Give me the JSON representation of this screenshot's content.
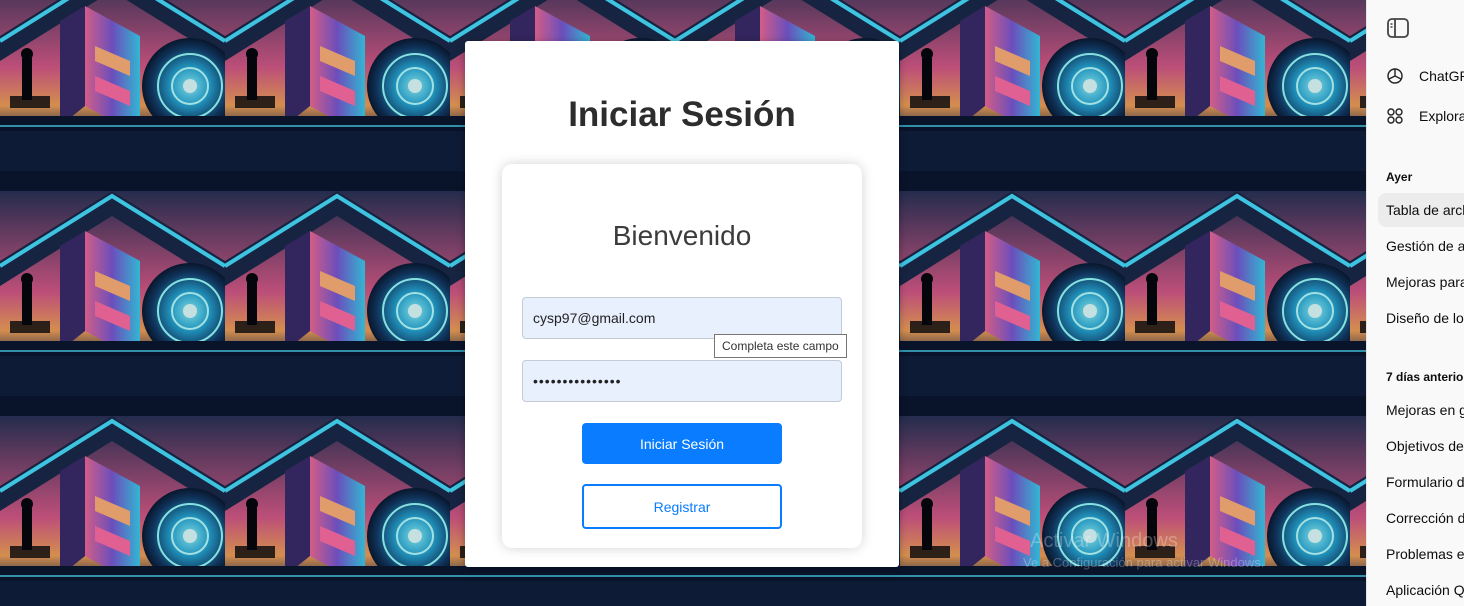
{
  "login": {
    "page_title": "Iniciar Sesión",
    "welcome": "Bienvenido",
    "email_value": "cysp97@gmail.com",
    "password_value": "•••••••••••••••",
    "tooltip": "Completa este campo",
    "login_button": "Iniciar Sesión",
    "register_button": "Registrar"
  },
  "watermark": {
    "line1": "Activar Windows",
    "line2": "Ve a Configuración para activar Windows."
  },
  "sidebar": {
    "top_items": [
      {
        "label": "ChatGP",
        "icon": "openai-icon"
      },
      {
        "label": "Explora",
        "icon": "grid-icon"
      }
    ],
    "sections": [
      {
        "title": "Ayer",
        "items": [
          "Tabla de arch",
          "Gestión de a",
          "Mejoras para",
          "Diseño de loc"
        ]
      },
      {
        "title": "7 días anterior",
        "items": [
          "Mejoras en g",
          "Objetivos de",
          "Formulario d",
          "Corrección d",
          "Problemas e",
          "Aplicación Q"
        ]
      }
    ]
  },
  "colors": {
    "primary": "#0a7cff",
    "field_bg": "#e8f0fe",
    "sidebar_bg": "#f9f9f9"
  }
}
